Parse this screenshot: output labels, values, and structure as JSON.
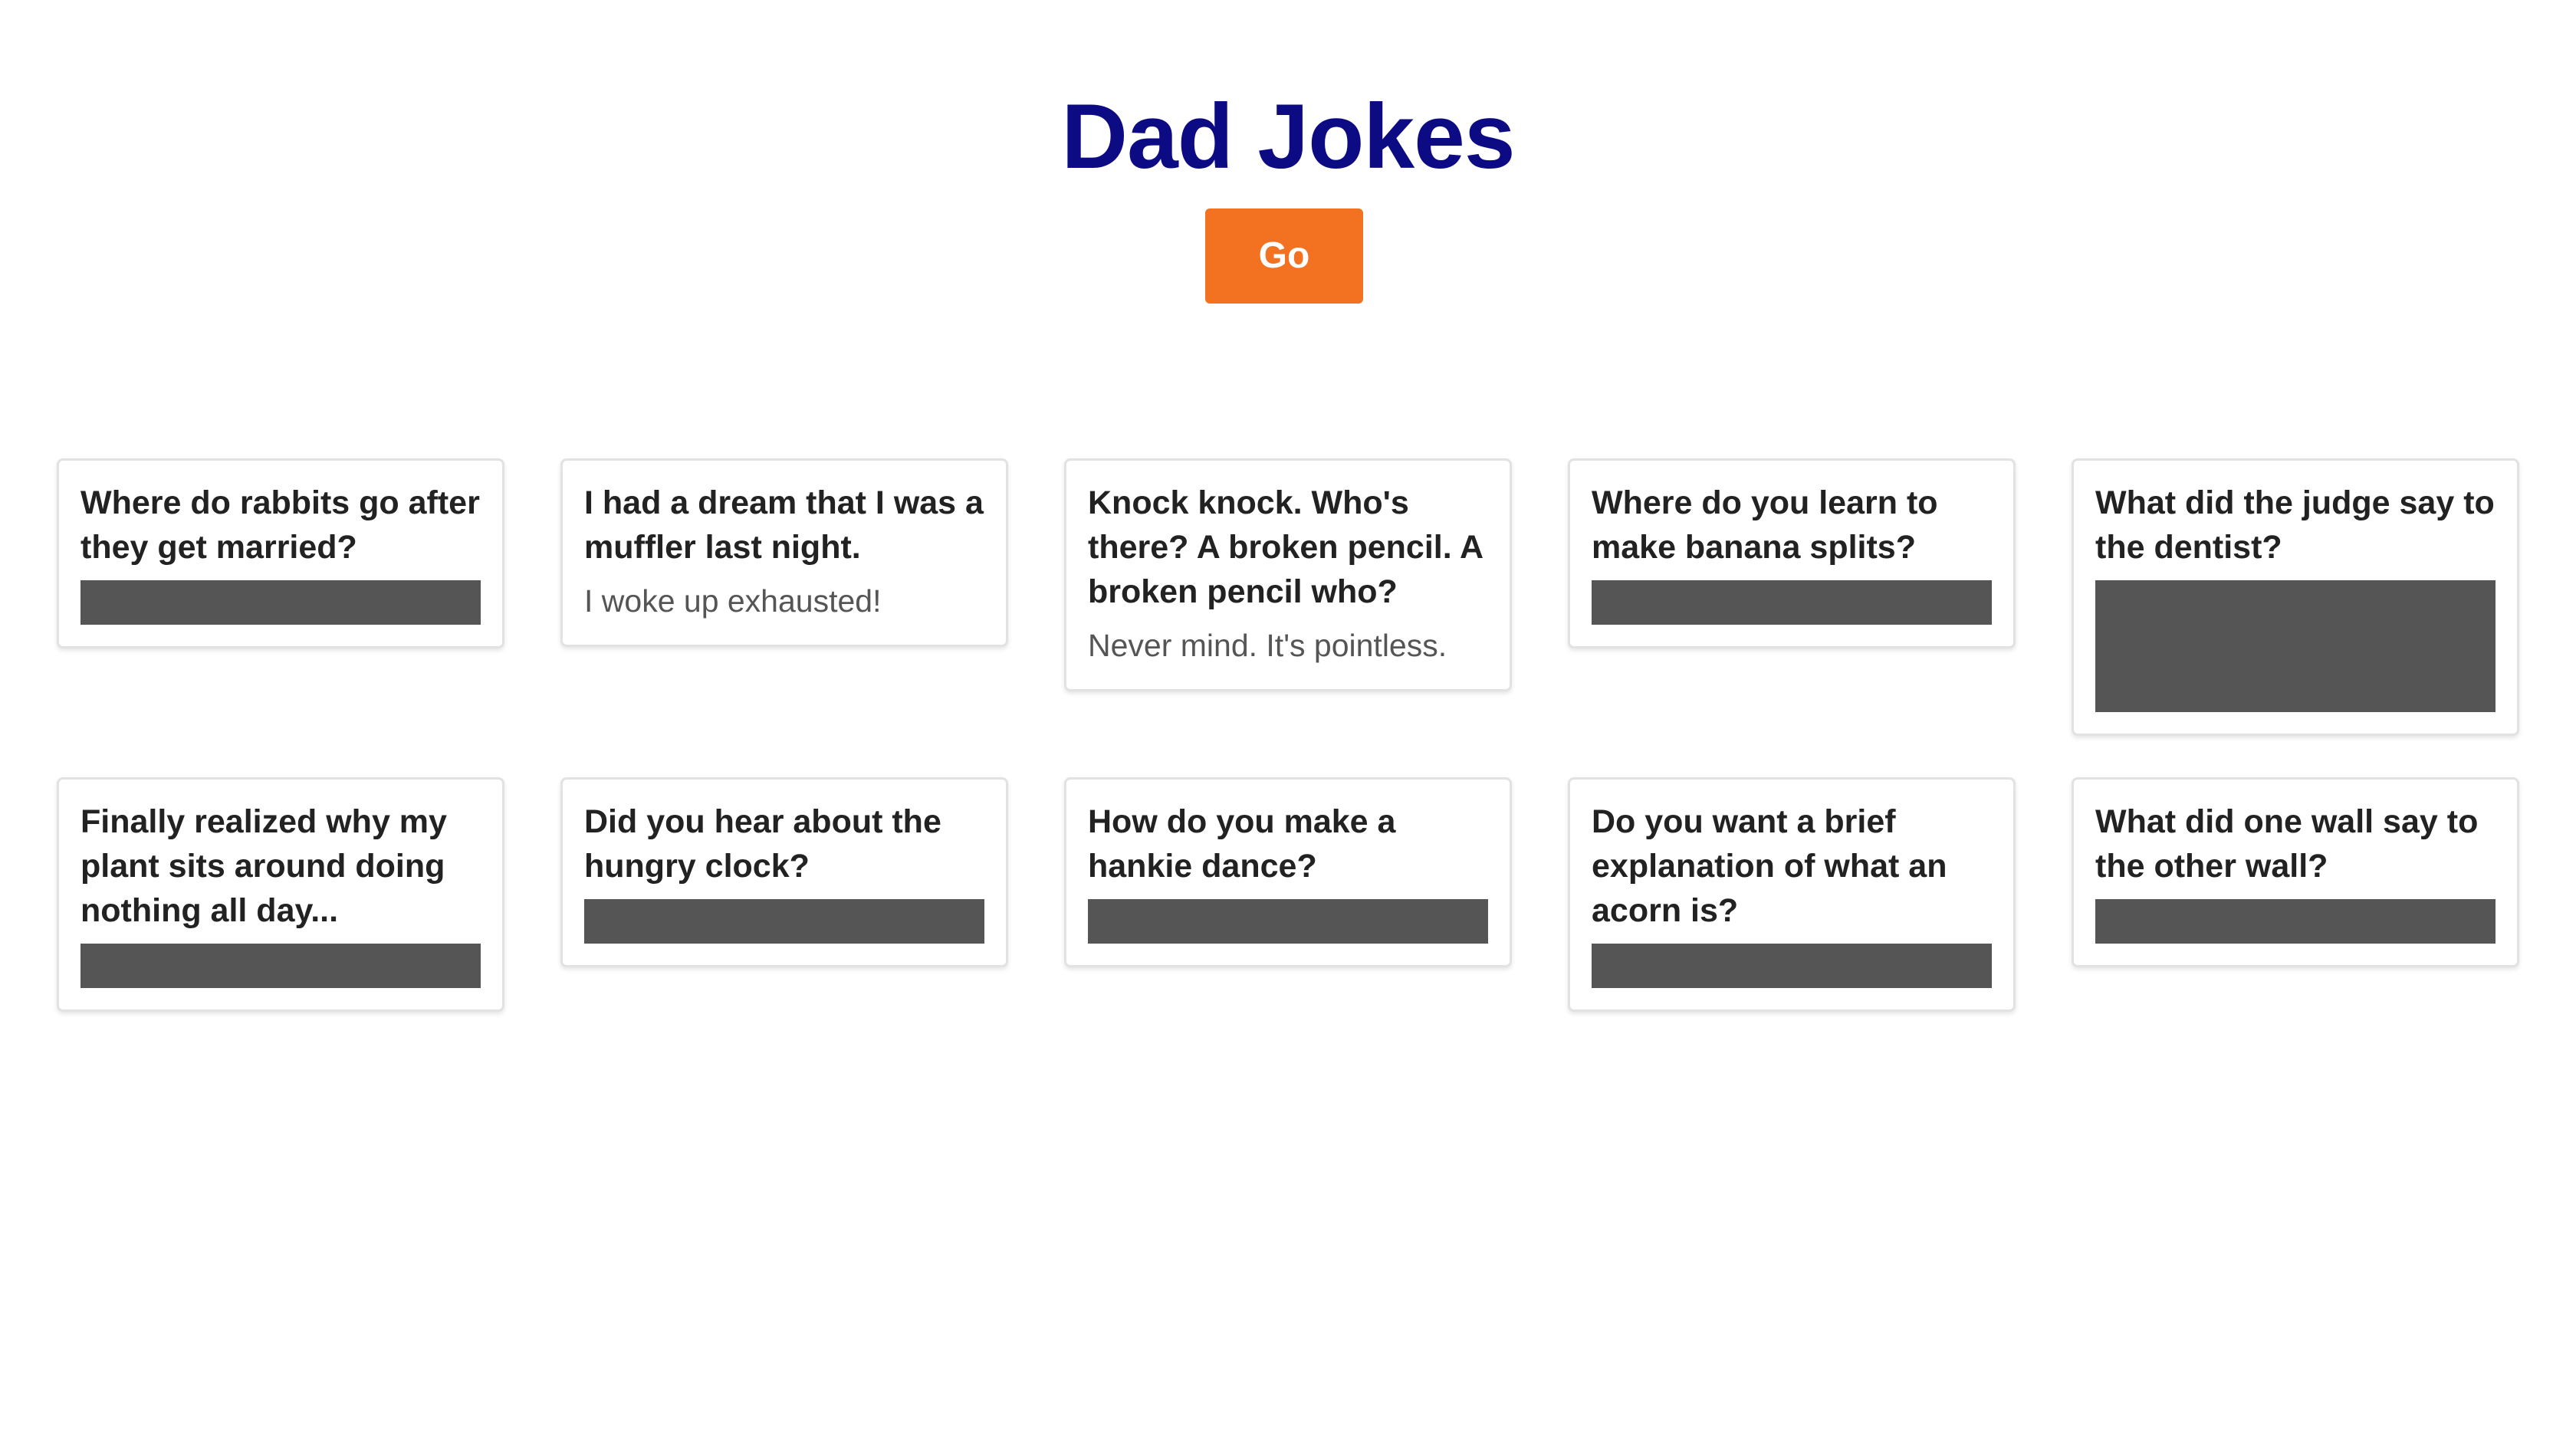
{
  "page": {
    "title": "Dad Jokes",
    "go_label": "Go",
    "colors": {
      "title": "#0c0b84",
      "button": "#f27222",
      "hidden_answer": "#555555"
    }
  },
  "jokes": [
    {
      "setup": "Where do rabbits go after they get married?",
      "punchline": "",
      "revealed": false
    },
    {
      "setup": "I had a dream that I was a muffler last night.",
      "punchline": "I woke up exhausted!",
      "revealed": true
    },
    {
      "setup": "Knock knock. Who's there? A broken pencil. A broken pencil who?",
      "punchline": "Never mind. It's pointless.",
      "revealed": true
    },
    {
      "setup": "Where do you learn to make banana splits?",
      "punchline": "",
      "revealed": false
    },
    {
      "setup": "What did the judge say to the dentist?",
      "punchline": "",
      "revealed": false
    },
    {
      "setup": "Finally realized why my plant sits around doing nothing all day...",
      "punchline": "",
      "revealed": false
    },
    {
      "setup": "Did you hear about the hungry clock?",
      "punchline": "",
      "revealed": false
    },
    {
      "setup": "How do you make a hankie dance?",
      "punchline": "",
      "revealed": false
    },
    {
      "setup": "Do you want a brief explanation of what an acorn is?",
      "punchline": "",
      "revealed": false
    },
    {
      "setup": "What did one wall say to the other wall?",
      "punchline": "",
      "revealed": false
    }
  ]
}
